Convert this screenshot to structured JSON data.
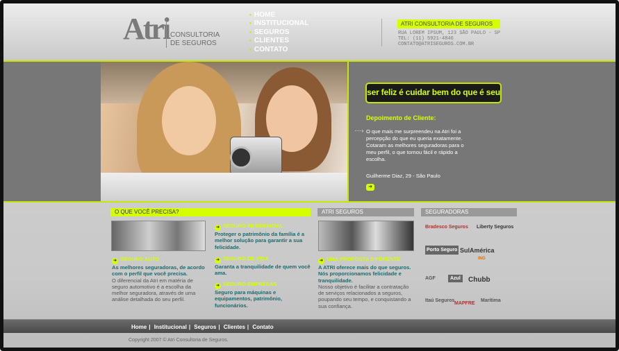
{
  "header": {
    "logo_mark": "Atri",
    "logo_text_line1": "CONSULTORIA",
    "logo_text_line2": "DE SEGUROS",
    "nav": [
      "HOME",
      "INSTITUCIONAL",
      "SEGUROS",
      "CLIENTES",
      "CONTATO"
    ],
    "company_name": "ATRI CONSULTORIA DE SEGUROS",
    "address_line1": "RUA LOREM IPSUM, 123 SÃO PAULO - SP",
    "address_line2": "TEL: (11) 5921-4846",
    "address_line3": "CONTATO@ATRISEGUROS.COM.BR"
  },
  "hero": {
    "slogan": "ser feliz é cuidar bem do que é seu",
    "testimonial_title": "Depoimento de Cliente:",
    "testimonial_body": "O que mais me surpreendeu na Atri foi a percepção do que eu queria exatamente. Cotaram as melhores seguradoras para o meu perfil, o que tornou fácil e rápido a escolha.",
    "testimonial_author": "Guilherme Diaz, 29 - São Paulo",
    "more_icon": "arrow-right-icon"
  },
  "columns": {
    "need_title": "O QUE VOCÊ PRECISA?",
    "atri_title": "ATRI SEGUROS",
    "insurers_title": "SEGURADORAS"
  },
  "services": {
    "residencial_title": "SEGURO RESIDENCIAL",
    "residencial_body": "Proteger o patrimônio da família é a melhor solução para garantir a sua felicidade.",
    "auto_title": "SEGURO AUTO",
    "auto_body": "As melhores seguradoras, de acordo com o perfil que você precisa.",
    "auto_extra": "O diferencial da Atri em matéria de seguro automotivo é a escolha da melhor seguradora, através de uma análise detalhada do seu perfil.",
    "vida_title": "SEGURO DE VIDA",
    "vida_body": "Garanta a tranquilidade de quem você ama.",
    "empresas_title": "SEGURO EMPRESAS",
    "empresas_body": "Seguro para máquinas e equipamentos, patrimônio, funcionários."
  },
  "atri": {
    "proposal_title": "UMA PROPOSTA DIFERENTE",
    "proposal_body": "A ATRI oferece mais do que seguros. Nós proporcionamos felicidade e tranquilidade.",
    "proposal_extra": "Nosso objetivo é facilitar a contratação de serviços relacionados a seguros, poupando seu tempo, e conquistando a sua confiança."
  },
  "insurers": [
    "Bradesco Seguros",
    "Liberty Seguros",
    "Porto Seguro",
    "SulAmérica",
    "ING",
    "AGF",
    "Azul",
    "Chubb",
    "Itaú Seguros",
    "MAPFRE",
    "Marítima"
  ],
  "footer": {
    "nav": [
      "Home",
      "Institucional",
      "Seguros",
      "Clientes",
      "Contato"
    ],
    "copyright": "Copyright 2007 © Atri Consultoria de Seguros."
  },
  "colors": {
    "accent": "#d5ff00",
    "teal_text": "#1d6a6a",
    "dark": "#1a1a1a"
  }
}
